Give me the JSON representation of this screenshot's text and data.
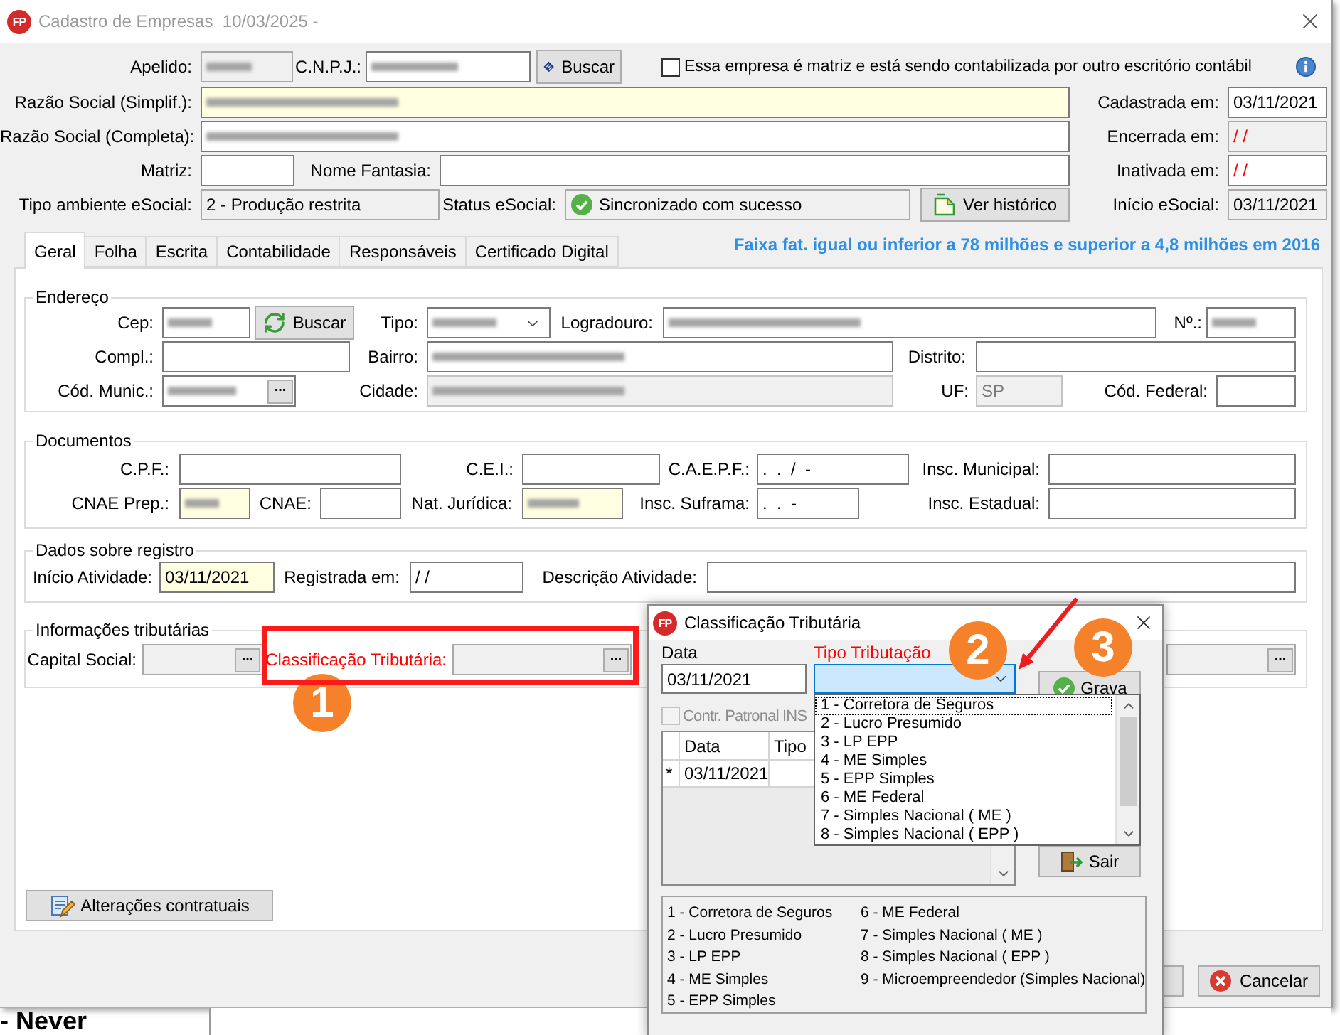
{
  "window": {
    "logo": "FP",
    "title": "Cadastro de Empresas  10/03/2025 -"
  },
  "header": {
    "lines": [
      {
        "entries": [
          {
            "label": "Apelido:",
            "kind": "field",
            "read_only": true,
            "disabled": false,
            "required": false,
            "masked": true
          },
          {
            "label": "C.N.P.J.:",
            "kind": "field",
            "read_only": false,
            "disabled": false,
            "required": false,
            "masked": true
          },
          {
            "kind": "button",
            "text": "Buscar"
          },
          {
            "kind": "checkbox",
            "text": "Essa empresa é matriz e está sendo contabilizada por outro escritório contábil",
            "checked": false
          },
          {
            "kind": "info"
          }
        ]
      },
      {
        "entries": [
          {
            "label": "Razão Social (Simplif.):",
            "kind": "field",
            "read_only": false,
            "disabled": false,
            "required": true,
            "masked": true
          },
          {
            "label": "Cadastrada em:",
            "kind": "field",
            "read_only": false,
            "disabled": false,
            "required": false,
            "value": "03/11/2021"
          }
        ]
      },
      {
        "entries": [
          {
            "label": "Razão Social (Completa):",
            "kind": "field",
            "read_only": false,
            "disabled": false,
            "required": false,
            "masked": true
          },
          {
            "label": "Encerrada em:",
            "kind": "field",
            "read_only": true,
            "disabled": false,
            "required": false,
            "value": "/ /",
            "alert": true
          }
        ]
      },
      {
        "entries": [
          {
            "label": "Matriz:",
            "kind": "field",
            "read_only": false,
            "disabled": false,
            "required": false
          },
          {
            "label": "Nome Fantasia:",
            "kind": "field",
            "read_only": false,
            "disabled": false,
            "required": false
          },
          {
            "label": "Inativada em:",
            "kind": "field",
            "read_only": false,
            "disabled": false,
            "required": false,
            "value": "/ /",
            "alert": true
          }
        ]
      },
      {
        "entries": [
          {
            "label": "Tipo ambiente eSocial:",
            "kind": "field",
            "read_only": true,
            "disabled": false,
            "required": false,
            "value": "2 - Produção restrita"
          },
          {
            "label": "Status eSocial:",
            "kind": "status",
            "read_only": true,
            "disabled": false,
            "required": false,
            "value": "Sincronizado com sucesso"
          },
          {
            "kind": "button",
            "text": "Ver histórico"
          },
          {
            "label": "Início eSocial:",
            "kind": "field",
            "read_only": true,
            "disabled": false,
            "required": false,
            "value": "03/11/2021"
          }
        ]
      }
    ]
  },
  "tabs": [
    {
      "label": "Geral",
      "selected": true
    },
    {
      "label": "Folha",
      "selected": false
    },
    {
      "label": "Escrita",
      "selected": false
    },
    {
      "label": "Contabilidade",
      "selected": false
    },
    {
      "label": "Responsáveis",
      "selected": false
    },
    {
      "label": "Certificado Digital",
      "selected": false
    }
  ],
  "notice": "Faixa fat. igual ou inferior a 78 milhões e superior a 4,8 milhões em 2016",
  "groups": [
    {
      "title": "Endereço",
      "lines": [
        {
          "entries": [
            {
              "label": "Cep:",
              "kind": "field",
              "read_only": false,
              "disabled": false,
              "required": false,
              "masked": true
            },
            {
              "kind": "button",
              "text": "Buscar"
            },
            {
              "label": "Tipo:",
              "kind": "select",
              "read_only": false,
              "disabled": false,
              "required": false,
              "masked": true
            },
            {
              "label": "Logradouro:",
              "kind": "field",
              "read_only": false,
              "disabled": false,
              "required": false,
              "masked": true
            },
            {
              "label": "Nº.:",
              "kind": "field",
              "read_only": false,
              "disabled": false,
              "required": false,
              "masked": true
            }
          ]
        },
        {
          "entries": [
            {
              "label": "Compl.:",
              "kind": "field",
              "read_only": false,
              "disabled": false,
              "required": false
            },
            {
              "label": "Bairro:",
              "kind": "field",
              "read_only": false,
              "disabled": false,
              "required": false,
              "masked": true
            },
            {
              "label": "Distrito:",
              "kind": "field",
              "read_only": false,
              "disabled": false,
              "required": false
            }
          ]
        },
        {
          "entries": [
            {
              "label": "Cód. Munic.:",
              "kind": "lookup",
              "read_only": false,
              "disabled": false,
              "required": false,
              "masked": true,
              "button": "..."
            },
            {
              "label": "Cidade:",
              "kind": "field",
              "read_only": false,
              "disabled": true,
              "required": false,
              "masked": true
            },
            {
              "label": "UF:",
              "kind": "field",
              "read_only": false,
              "disabled": true,
              "required": false,
              "value": "SP"
            },
            {
              "label": "Cód. Federal:",
              "kind": "field",
              "read_only": false,
              "disabled": false,
              "required": false
            }
          ]
        }
      ]
    },
    {
      "title": "Documentos",
      "lines": [
        {
          "entries": [
            {
              "label": "C.P.F.:",
              "kind": "field",
              "read_only": false,
              "disabled": false,
              "required": false
            },
            {
              "label": "C.E.I.:",
              "kind": "field",
              "read_only": false,
              "disabled": false,
              "required": false
            },
            {
              "label": "C.A.E.P.F.:",
              "kind": "field",
              "read_only": false,
              "disabled": false,
              "required": false,
              "value": ".  .  /  -"
            },
            {
              "label": "Insc. Municipal:",
              "kind": "field",
              "read_only": false,
              "disabled": false,
              "required": false
            }
          ]
        },
        {
          "entries": [
            {
              "label": "CNAE Prep.:",
              "kind": "field",
              "read_only": false,
              "disabled": false,
              "required": true,
              "masked": true
            },
            {
              "label": "CNAE:",
              "kind": "field",
              "read_only": false,
              "disabled": false,
              "required": false
            },
            {
              "label": "Nat. Jurídica:",
              "kind": "field",
              "read_only": false,
              "disabled": false,
              "required": true,
              "masked": true
            },
            {
              "label": "Insc. Suframa:",
              "kind": "field",
              "read_only": false,
              "disabled": false,
              "required": false,
              "value": ".  .  -"
            },
            {
              "label": "Insc. Estadual:",
              "kind": "field",
              "read_only": false,
              "disabled": false,
              "required": false
            }
          ]
        }
      ]
    },
    {
      "title": "Dados sobre registro",
      "lines": [
        {
          "entries": [
            {
              "label": "Início Atividade:",
              "kind": "field",
              "read_only": false,
              "disabled": false,
              "required": true,
              "value": "03/11/2021"
            },
            {
              "label": "Registrada em:",
              "kind": "field",
              "read_only": false,
              "disabled": false,
              "required": false,
              "value": "/ /"
            },
            {
              "label": "Descrição Atividade:",
              "kind": "field",
              "read_only": false,
              "disabled": false,
              "required": false
            }
          ]
        }
      ]
    },
    {
      "title": "Informações tributárias",
      "lines": [
        {
          "entries": [
            {
              "label": "Capital Social:",
              "kind": "lookup",
              "read_only": true,
              "disabled": false,
              "required": false,
              "button": "..."
            },
            {
              "label": "Classificação Tributária:",
              "label_alert": true,
              "kind": "lookup",
              "read_only": true,
              "disabled": false,
              "required": false,
              "button": "..."
            },
            {
              "kind": "lookup",
              "read_only": true,
              "disabled": false,
              "required": false,
              "button": "..."
            }
          ]
        }
      ]
    }
  ],
  "contract_button": "Alterações contratuais",
  "cancel_button": "Cancelar",
  "dialog": {
    "logo": "FP",
    "title": "Classificação Tributária",
    "fields": [
      {
        "kind": "date",
        "label": "Data",
        "value": "03/11/2021"
      },
      {
        "kind": "combo",
        "label": "Tipo Tributação",
        "label_alert": true,
        "expanded": true
      }
    ],
    "options": [
      {
        "label": "1 - Corretora de Seguros",
        "selected": true
      },
      {
        "label": "2 - Lucro Presumido",
        "selected": false
      },
      {
        "label": "3 - LP EPP",
        "selected": false
      },
      {
        "label": "4 - ME Simples",
        "selected": false
      },
      {
        "label": "5 - EPP Simples",
        "selected": false
      },
      {
        "label": "6 - ME Federal",
        "selected": false
      },
      {
        "label": "7 - Simples Nacional ( ME )",
        "selected": false
      },
      {
        "label": "8 - Simples Nacional ( EPP )",
        "selected": false
      }
    ],
    "checkbox": {
      "label": "Contr. Patronal INS",
      "checked": false,
      "disabled": true
    },
    "grid": {
      "columns": [
        "Data",
        "Tipo"
      ],
      "rows": [
        {
          "marker": "*",
          "cells": [
            "03/11/2021"
          ]
        }
      ]
    },
    "buttons": [
      "Grava",
      "Sair"
    ],
    "legend": [
      "1 - Corretora de Seguros",
      "2 - Lucro Presumido",
      "3 - LP EPP",
      "4 - ME Simples",
      "5 - EPP Simples",
      "6 - ME Federal",
      "7 - Simples Nacional ( ME )",
      "8 - Simples Nacional ( EPP )",
      "9 - Microempreendedor (Simples Nacional)"
    ]
  },
  "annotations": [
    {
      "text": "1"
    },
    {
      "text": "2"
    },
    {
      "text": "3"
    }
  ],
  "background": {
    "text": "- Never"
  }
}
